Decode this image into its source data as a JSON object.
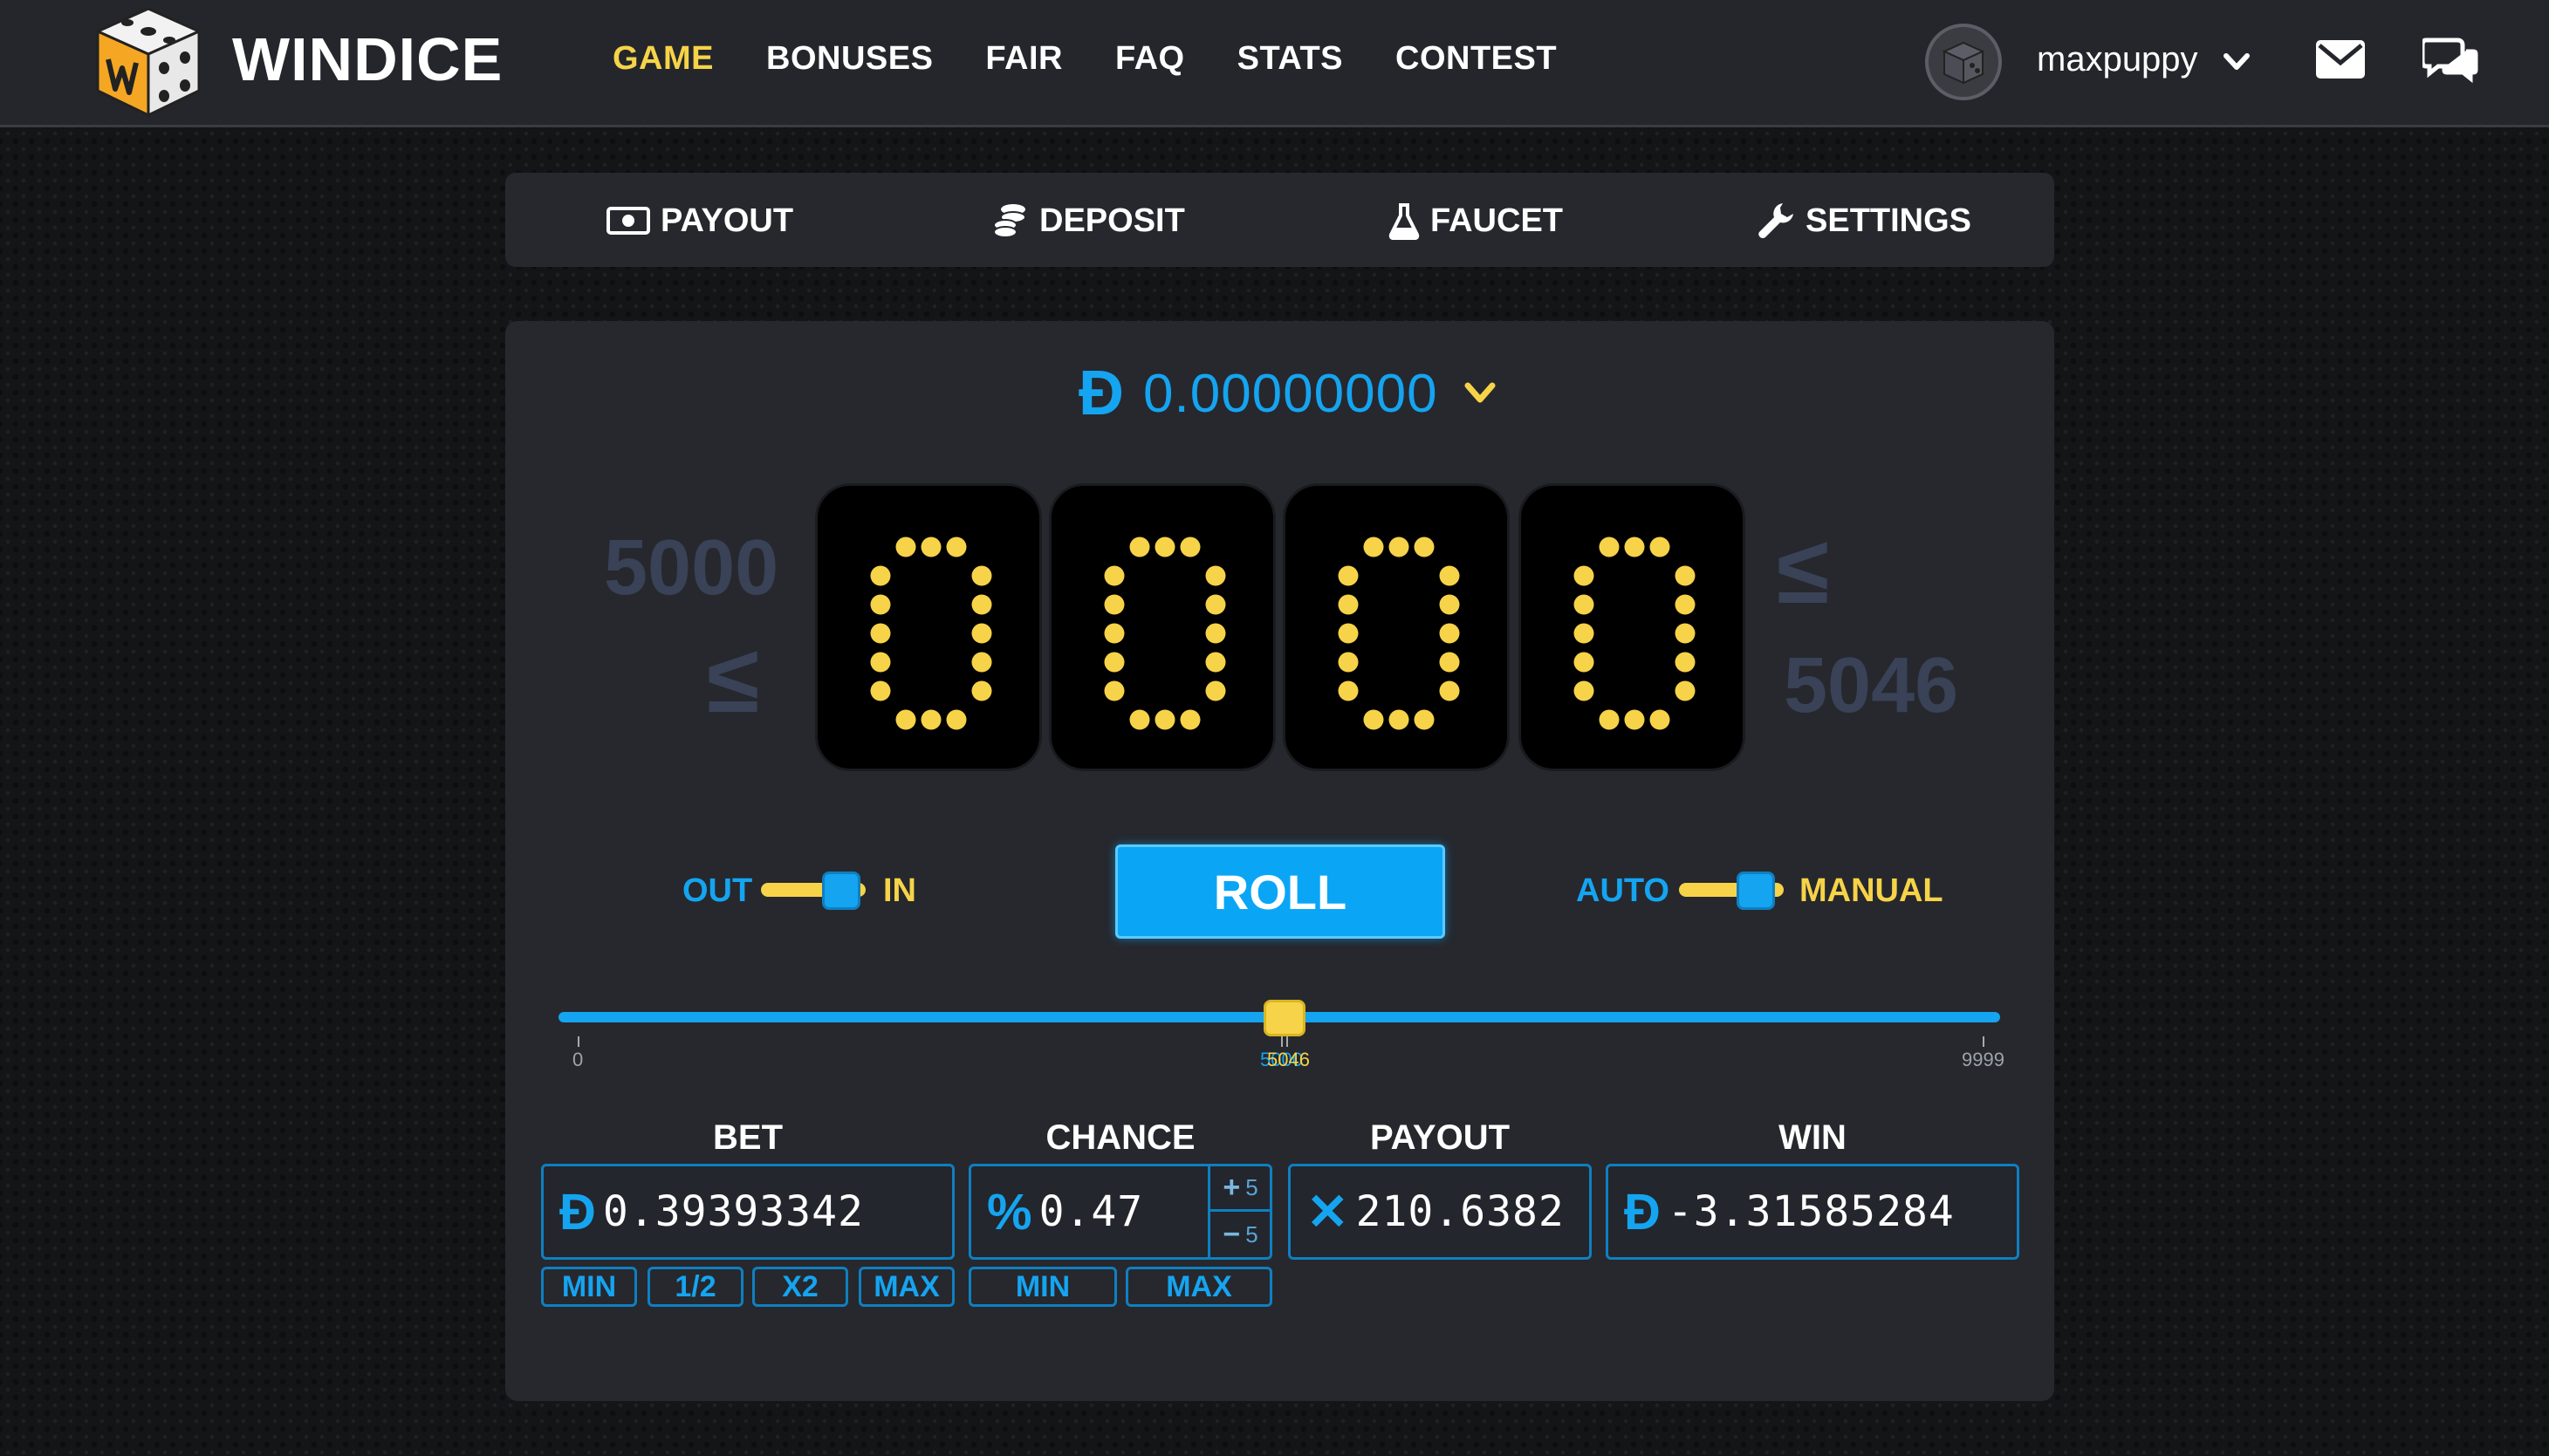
{
  "brand": {
    "name": "WINDICE"
  },
  "nav": {
    "items": [
      "GAME",
      "BONUSES",
      "FAIR",
      "FAQ",
      "STATS",
      "CONTEST"
    ],
    "active": "GAME"
  },
  "user": {
    "name": "maxpuppy"
  },
  "tabs": {
    "payout": "PAYOUT",
    "deposit": "DEPOSIT",
    "faucet": "FAUCET",
    "settings": "SETTINGS"
  },
  "balance": {
    "symbol": "Đ",
    "value": "0.00000000"
  },
  "roll_display": {
    "digits": [
      "0",
      "0",
      "0",
      "0"
    ],
    "range_low": "5000",
    "range_high": "5046",
    "comparator": "≤"
  },
  "toggles": {
    "direction": {
      "left": "OUT",
      "right": "IN",
      "state": "IN"
    },
    "mode": {
      "left": "AUTO",
      "right": "MANUAL",
      "state": "MANUAL"
    }
  },
  "roll_button": "ROLL",
  "slider": {
    "min": 0,
    "max": 9999,
    "value": 5046,
    "min_label": "0",
    "max_label": "9999",
    "value_label": "5046",
    "overlap_label": "5000"
  },
  "bet": {
    "title": "BET",
    "prefix": "Đ",
    "value": "0.39393342",
    "buttons": [
      "MIN",
      "1/2",
      "X2",
      "MAX"
    ]
  },
  "chance": {
    "title": "CHANCE",
    "prefix": "%",
    "value": "0.47",
    "buttons": [
      "MIN",
      "MAX"
    ],
    "step_up": "+",
    "step_down": "−",
    "step_amount": "5"
  },
  "payout": {
    "title": "PAYOUT",
    "prefix": "✕",
    "value": "210.6382"
  },
  "win": {
    "title": "WIN",
    "prefix": "Đ",
    "value": "-3.31585284"
  },
  "colors": {
    "accent_yellow": "#f6d348",
    "accent_blue": "#15a4f0",
    "panel": "#26282e",
    "muted_range": "#394256"
  }
}
